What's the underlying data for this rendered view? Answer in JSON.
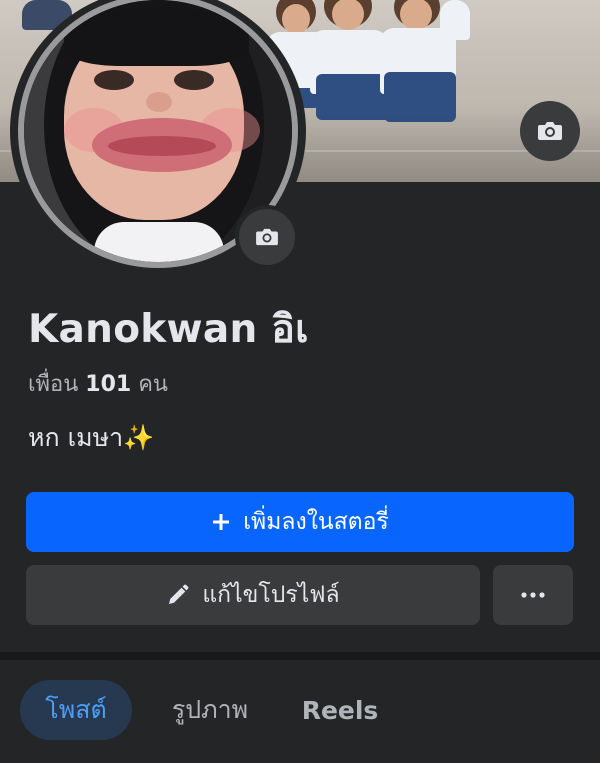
{
  "profile": {
    "name": "Kanokwan อิเ",
    "friends_prefix": "เพื่อน",
    "friends_count": "101",
    "friends_suffix": "คน",
    "bio": "หก เมษา✨"
  },
  "buttons": {
    "add_story_icon": "+",
    "add_story": "เพิ่มลงในสตอรี่",
    "edit_profile": "แก้ไขโปรไฟล์",
    "more": "···"
  },
  "tabs": {
    "posts": "โพสต์",
    "photos": "รูปภาพ",
    "reels": "Reels"
  },
  "icons": {
    "cover_camera": "camera-icon",
    "avatar_camera": "camera-icon",
    "edit": "pencil-icon",
    "add": "plus-icon",
    "more": "more-dots-icon"
  },
  "colors": {
    "background": "#242526",
    "primary_button": "#0866ff",
    "secondary_button": "#3a3b3c",
    "active_tab_bg": "#263951",
    "active_tab_text": "#4d9ef7"
  }
}
